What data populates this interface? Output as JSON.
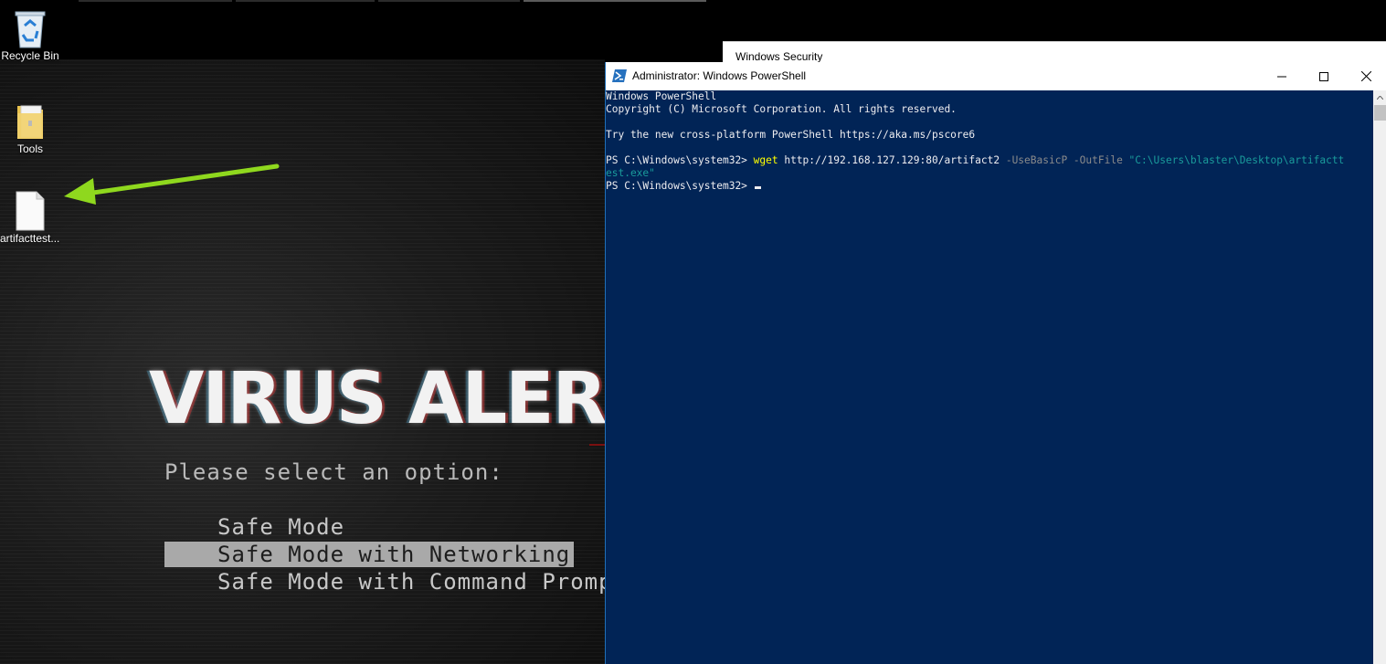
{
  "desktop": {
    "icons": [
      {
        "label": "Recycle Bin"
      },
      {
        "label": "Tools"
      },
      {
        "label": "artifacttest...."
      }
    ],
    "arrow_color": "#8fd81e"
  },
  "wallpaper": {
    "title": "VIRUS ALER",
    "prompt": "Please select an option:",
    "options": [
      "Safe Mode",
      "Safe Mode with Networking",
      "Safe Mode with Command Promp"
    ],
    "selected_index": 1
  },
  "background_window": {
    "title": "Windows Security"
  },
  "powershell": {
    "title": "Administrator: Windows PowerShell",
    "colors": {
      "background": "#012456",
      "text": "#eeedf0",
      "command": "#ffff00",
      "parameter": "#8b8b8b",
      "string": "#1a9b9b"
    },
    "lines": {
      "banner1": "Windows PowerShell",
      "banner2": "Copyright (C) Microsoft Corporation. All rights reserved.",
      "banner3": "Try the new cross-platform PowerShell https://aka.ms/pscore6",
      "prompt": "PS C:\\Windows\\system32> ",
      "cmd_name": "wget",
      "cmd_url": " http://192.168.127.129:80/artifact2 ",
      "param1": "-UseBasicP",
      "param2": " -OutFile ",
      "str_part1": "\"C:\\Users\\blaster\\Desktop\\artifactt",
      "str_part2": "est.exe\"",
      "prompt2": "PS C:\\Windows\\system32> "
    }
  }
}
